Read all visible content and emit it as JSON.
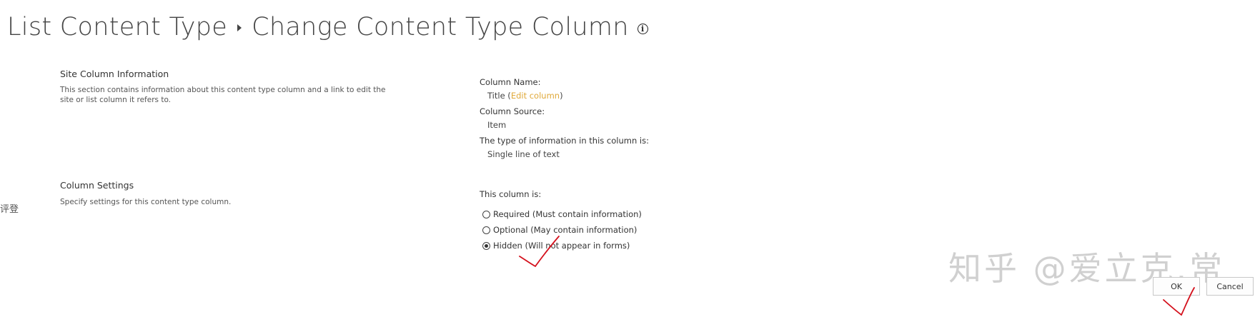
{
  "header": {
    "crumb_parent": "List Content Type",
    "title": "Change Content Type Column"
  },
  "left_cut_text": "评登",
  "site_column_info": {
    "title": "Site Column Information",
    "description": "This section contains information about this content type column and a link to edit the site or list column it refers to."
  },
  "column_details": {
    "name_label": "Column Name:",
    "name_value": "Title",
    "edit_link": "Edit column",
    "source_label": "Column Source:",
    "source_value": "Item",
    "type_label": "The type of information in this column is:",
    "type_value": "Single line of text"
  },
  "column_settings": {
    "title": "Column Settings",
    "description": "Specify settings for this content type column.",
    "status_label": "This column is:",
    "options": [
      {
        "label": "Required (Must contain information)",
        "selected": false
      },
      {
        "label": "Optional (May contain information)",
        "selected": false
      },
      {
        "label": "Hidden (Will not appear in forms)",
        "selected": true
      }
    ]
  },
  "buttons": {
    "ok": "OK",
    "cancel": "Cancel"
  },
  "watermark": "知乎 @爱立克.常",
  "colors": {
    "link": "#e0a93a",
    "annotation": "#d4101c"
  }
}
